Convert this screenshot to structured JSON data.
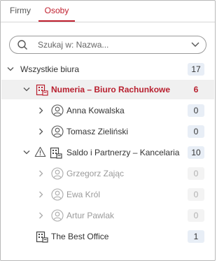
{
  "tabs": [
    {
      "label": "Firmy"
    },
    {
      "label": "Osoby"
    }
  ],
  "search": {
    "placeholder": "Szukaj w: Nazwa..."
  },
  "tree": {
    "root": {
      "label": "Wszystkie biura",
      "count": "17"
    },
    "office1": {
      "label": "Numeria – Biuro Rachunkowe",
      "count": "6"
    },
    "person1": {
      "label": "Anna Kowalska",
      "count": "0"
    },
    "person2": {
      "label": "Tomasz Zieliński",
      "count": "0"
    },
    "office2": {
      "label": "Saldo i Partnerzy – Kancelaria",
      "count": "10"
    },
    "person3": {
      "label": "Grzegorz Zając",
      "count": "0"
    },
    "person4": {
      "label": "Ewa Król",
      "count": "0"
    },
    "person5": {
      "label": "Artur Pawlak",
      "count": "0"
    },
    "office3": {
      "label": "The Best Office",
      "count": "1"
    }
  },
  "colors": {
    "accent": "#c0202f",
    "badge_bg": "#e8eef6",
    "selected_bg": "#f0f0f0"
  }
}
